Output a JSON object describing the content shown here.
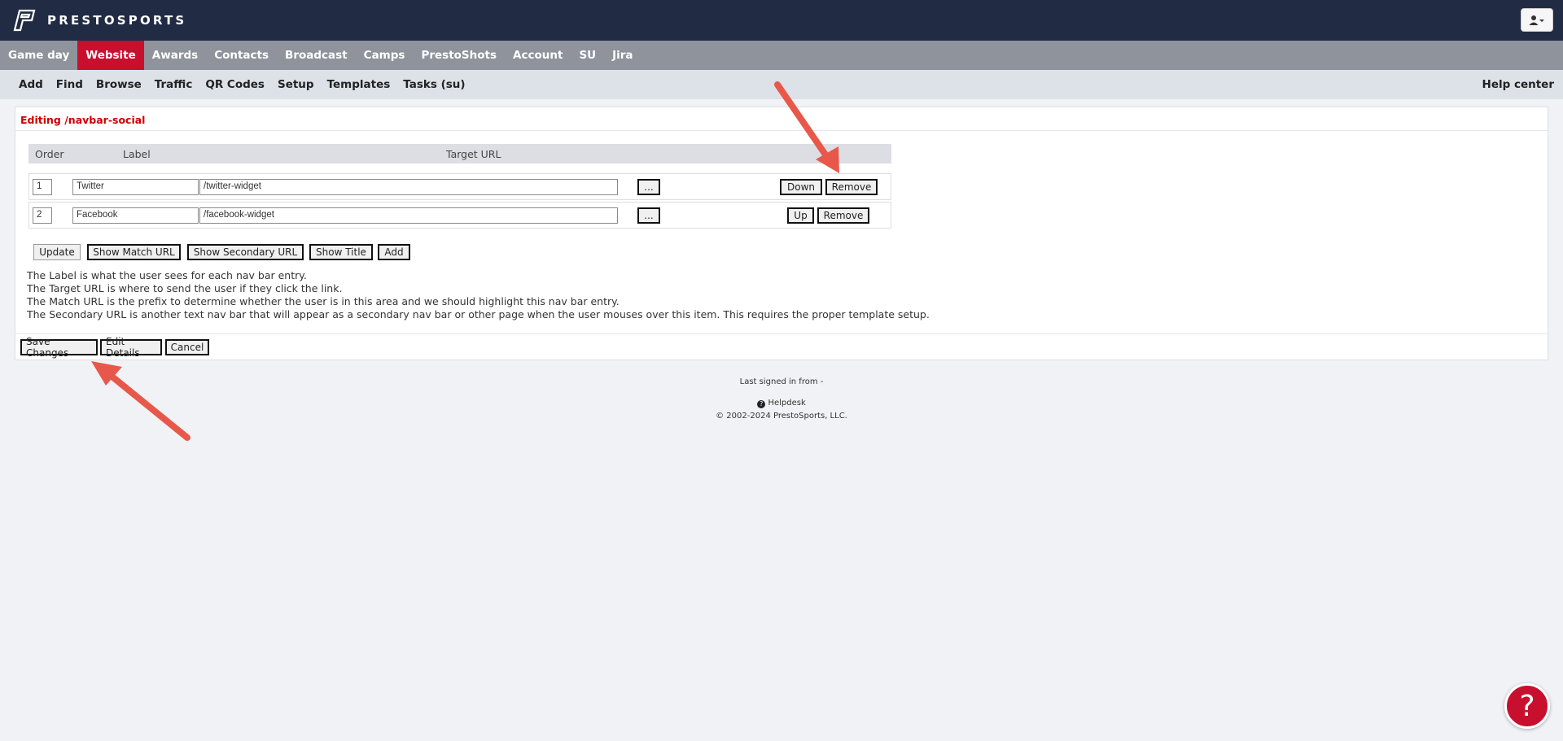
{
  "brand": {
    "name": "PRESTOSPORTS"
  },
  "main_nav": [
    "Game day",
    "Website",
    "Awards",
    "Contacts",
    "Broadcast",
    "Camps",
    "PrestoShots",
    "Account",
    "SU",
    "Jira"
  ],
  "main_nav_active": "Website",
  "sub_nav": [
    "Add",
    "Find",
    "Browse",
    "Traffic",
    "QR Codes",
    "Setup",
    "Templates",
    "Tasks (su)"
  ],
  "help_center": "Help center",
  "panel": {
    "title": "Editing /navbar-social",
    "headers": {
      "order": "Order",
      "label": "Label",
      "target": "Target URL"
    },
    "rows": [
      {
        "order": "1",
        "label": "Twitter",
        "target": "/twitter-widget",
        "browse": "...",
        "move": "Down",
        "remove": "Remove"
      },
      {
        "order": "2",
        "label": "Facebook",
        "target": "/facebook-widget",
        "browse": "...",
        "move": "Up",
        "remove": "Remove"
      }
    ],
    "actions": {
      "update": "Update",
      "match": "Show Match URL",
      "secondary": "Show Secondary URL",
      "title": "Show Title",
      "add": "Add"
    },
    "help": [
      "The Label is what the user sees for each nav bar entry.",
      "The Target URL is where to send the user if they click the link.",
      "The Match URL is the prefix to determine whether the user is in this area and we should highlight this nav bar entry.",
      "The Secondary URL is another text nav bar that will appear as a secondary nav bar or other page when the user mouses over this item. This requires the proper template setup."
    ],
    "footer_buttons": {
      "save": "Save Changes",
      "details": "Edit Details",
      "cancel": "Cancel"
    }
  },
  "footer": {
    "last_signed": "Last signed in from -",
    "helpdesk": "Helpdesk",
    "copyright": "© 2002-2024 PrestoSports, LLC."
  },
  "colors": {
    "brand_bar": "#212b44",
    "accent_red": "#c8102e",
    "annotation_arrow": "#e8584a"
  }
}
